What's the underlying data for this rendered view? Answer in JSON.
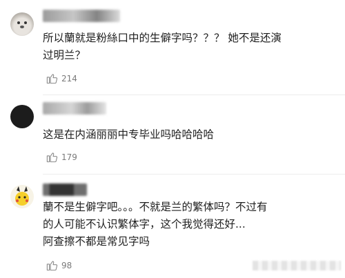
{
  "comments": [
    {
      "lines": [
        "所以蘭就是粉絲口中的生僻字吗？？？ 她不是还演",
        "过明兰？"
      ],
      "likes": "214"
    },
    {
      "lines": [
        "这是在内涵丽丽中专毕业吗哈哈哈哈"
      ],
      "likes": "179"
    },
    {
      "lines": [
        "蘭不是生僻字吧。。。不就是兰的繁体吗？不过有",
        "的人可能不认识繁体字，这个我觉得还好...",
        "阿查擦不都是常见字吗"
      ],
      "likes": "98"
    }
  ],
  "icons": {
    "like": "thumbs-up-icon"
  }
}
